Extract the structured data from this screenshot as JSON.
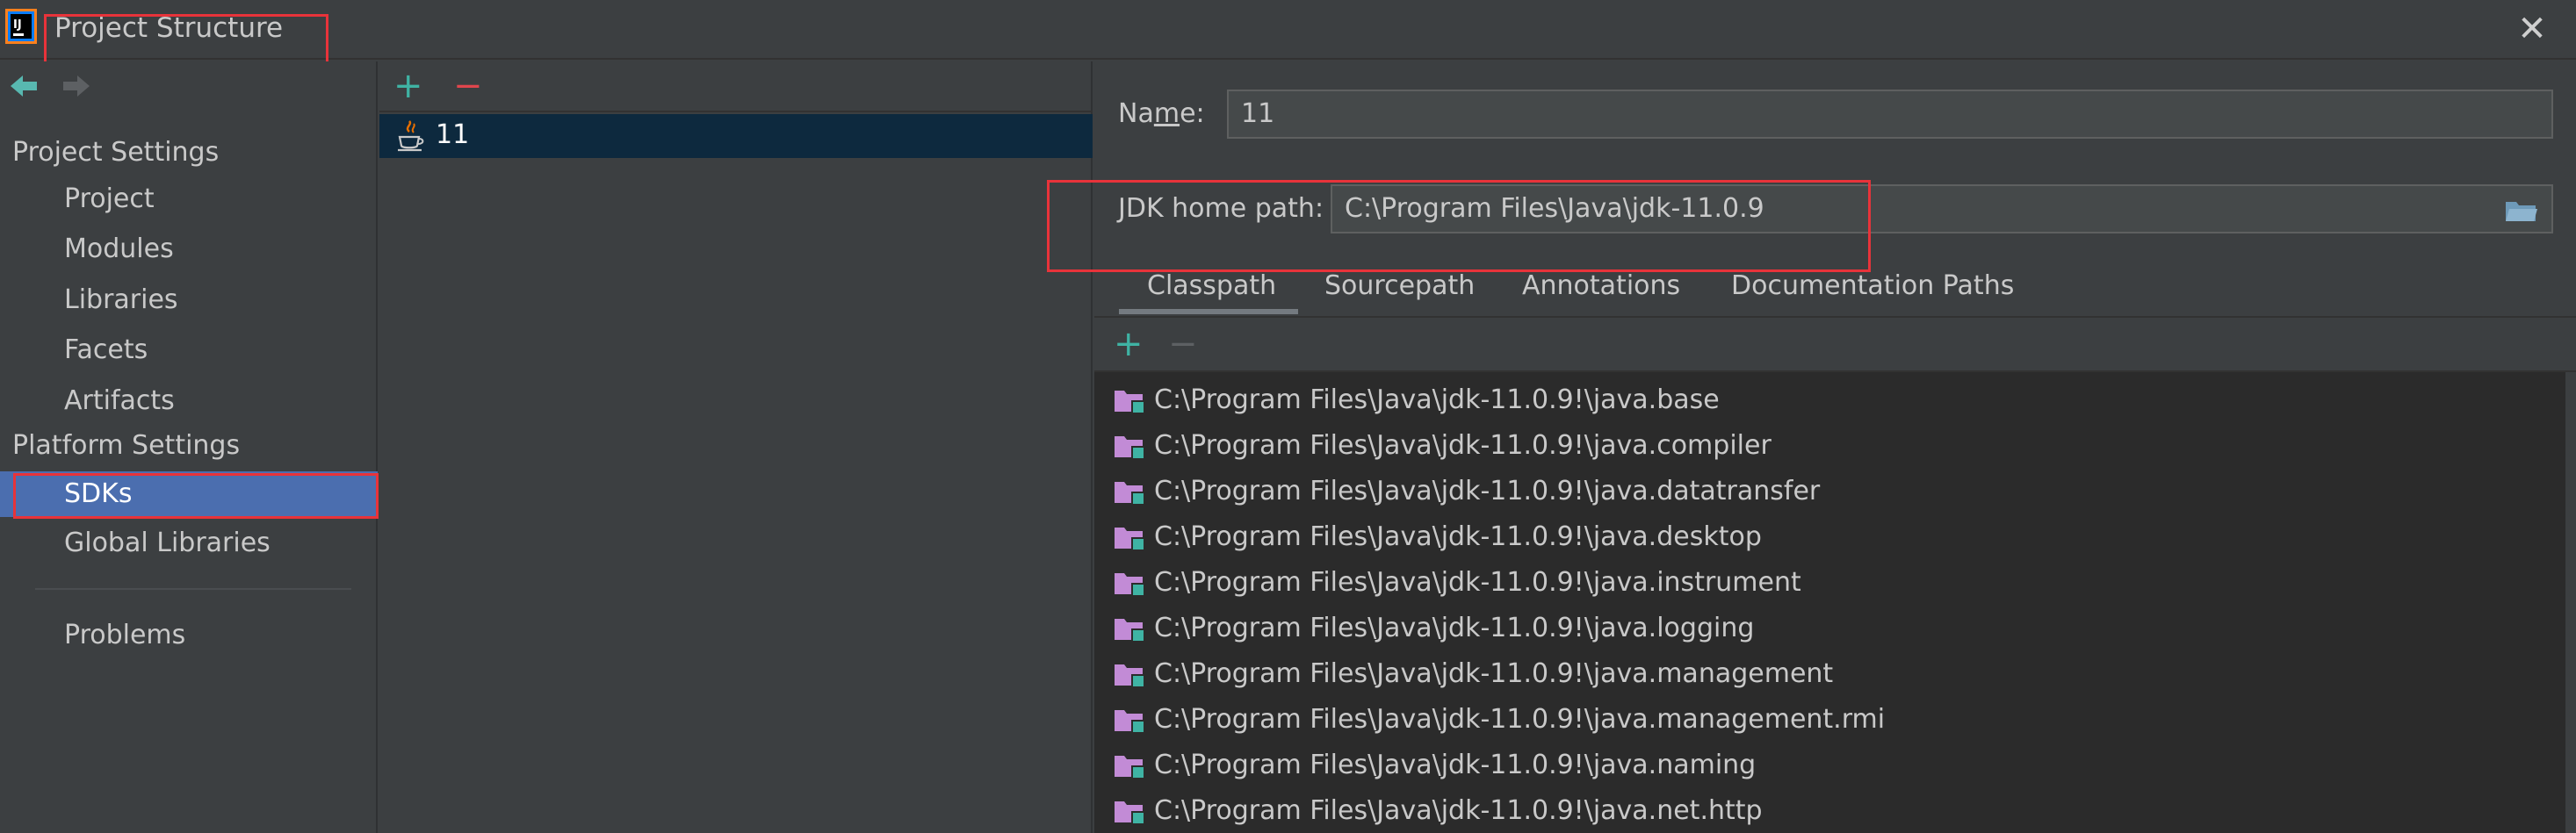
{
  "window": {
    "title": "Project Structure",
    "close_label": "✕"
  },
  "nav": {
    "back_icon": "arrow-left-icon",
    "forward_icon": "arrow-right-icon"
  },
  "sidebar": {
    "project_settings_title": "Project Settings",
    "project_items": [
      {
        "label": "Project"
      },
      {
        "label": "Modules"
      },
      {
        "label": "Libraries"
      },
      {
        "label": "Facets"
      },
      {
        "label": "Artifacts"
      }
    ],
    "platform_settings_title": "Platform Settings",
    "platform_items": [
      {
        "label": "SDKs",
        "selected": true
      },
      {
        "label": "Global Libraries",
        "selected": false
      }
    ],
    "problems_label": "Problems"
  },
  "sdk_list": {
    "add_label": "+",
    "remove_label": "−",
    "items": [
      {
        "label": "11",
        "selected": true
      }
    ]
  },
  "detail": {
    "name_label": "Name:",
    "name_label_mnemonic_prefix": "Na",
    "name_label_mnemonic_char": "m",
    "name_label_mnemonic_suffix": "e:",
    "name_value": "11",
    "jdk_home_label": "JDK home path:",
    "jdk_home_value": "C:\\Program Files\\Java\\jdk-11.0.9",
    "tabs": [
      {
        "label": "Classpath",
        "active": true
      },
      {
        "label": "Sourcepath",
        "active": false
      },
      {
        "label": "Annotations",
        "active": false
      },
      {
        "label": "Documentation Paths",
        "active": false
      }
    ],
    "classpath_add_label": "+",
    "classpath_remove_label": "−",
    "classpath_entries": [
      "C:\\Program Files\\Java\\jdk-11.0.9!\\java.base",
      "C:\\Program Files\\Java\\jdk-11.0.9!\\java.compiler",
      "C:\\Program Files\\Java\\jdk-11.0.9!\\java.datatransfer",
      "C:\\Program Files\\Java\\jdk-11.0.9!\\java.desktop",
      "C:\\Program Files\\Java\\jdk-11.0.9!\\java.instrument",
      "C:\\Program Files\\Java\\jdk-11.0.9!\\java.logging",
      "C:\\Program Files\\Java\\jdk-11.0.9!\\java.management",
      "C:\\Program Files\\Java\\jdk-11.0.9!\\java.management.rmi",
      "C:\\Program Files\\Java\\jdk-11.0.9!\\java.naming",
      "C:\\Program Files\\Java\\jdk-11.0.9!\\java.net.http"
    ]
  },
  "colors": {
    "background": "#3c3f41",
    "list_background": "#2b2b2b",
    "selection": "#4b6eaf",
    "selection_dark": "#0d293e",
    "add_green": "#3fb3a4",
    "remove_red": "#e0464d",
    "highlight_red": "#e8333a",
    "folder_purple": "#c28bd6"
  }
}
